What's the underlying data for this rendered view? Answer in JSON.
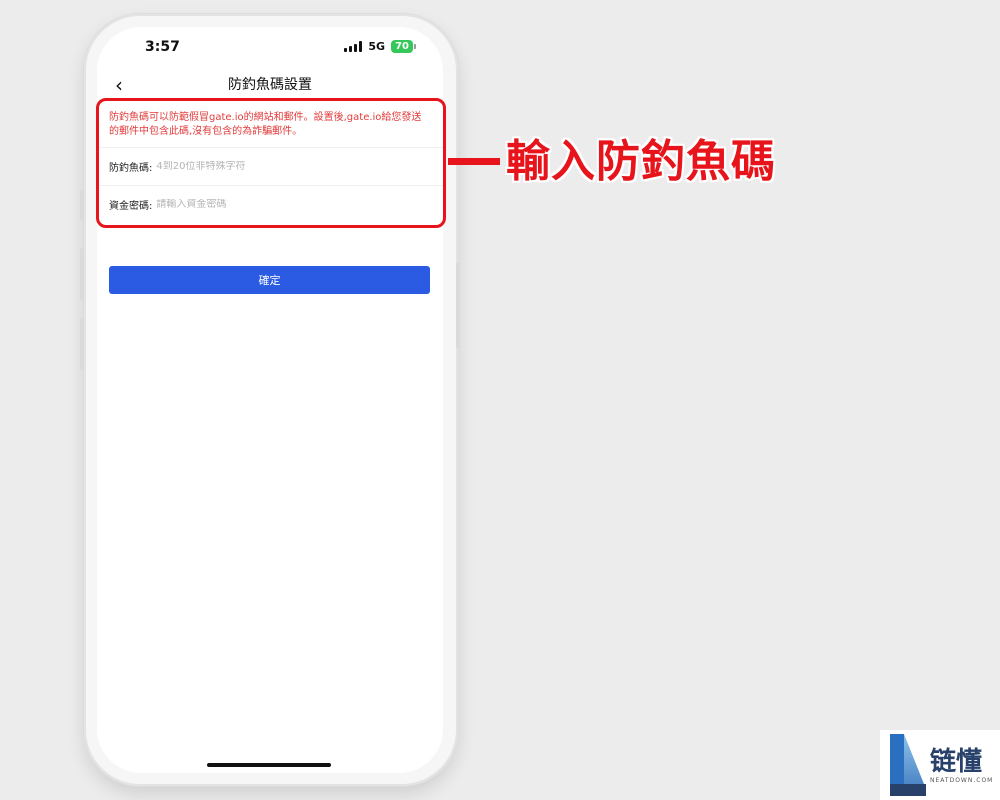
{
  "status_bar": {
    "time": "3:57",
    "network": "5G",
    "battery": "70"
  },
  "nav": {
    "back_icon": "chevron-left-icon",
    "title": "防釣魚碼設置"
  },
  "form": {
    "notice": "防釣魚碼可以防範假冒gate.io的網站和郵件。設置後,gate.io給您發送的郵件中包含此碼,沒有包含的為詐騙郵件。",
    "anti_phishing": {
      "label": "防釣魚碼:",
      "placeholder": "4到20位非特殊字符",
      "value": ""
    },
    "fund_password": {
      "label": "資金密碼:",
      "placeholder": "請輸入資金密碼",
      "value": ""
    },
    "confirm_label": "確定"
  },
  "annotation": {
    "callout": "輸入防釣魚碼",
    "color": "#e8141b"
  },
  "watermark": {
    "name": "链懂",
    "domain": "NEATDOWN.COM"
  },
  "colors": {
    "primary": "#2b5be3",
    "notice": "#e23b3b",
    "battery": "#35c759"
  }
}
